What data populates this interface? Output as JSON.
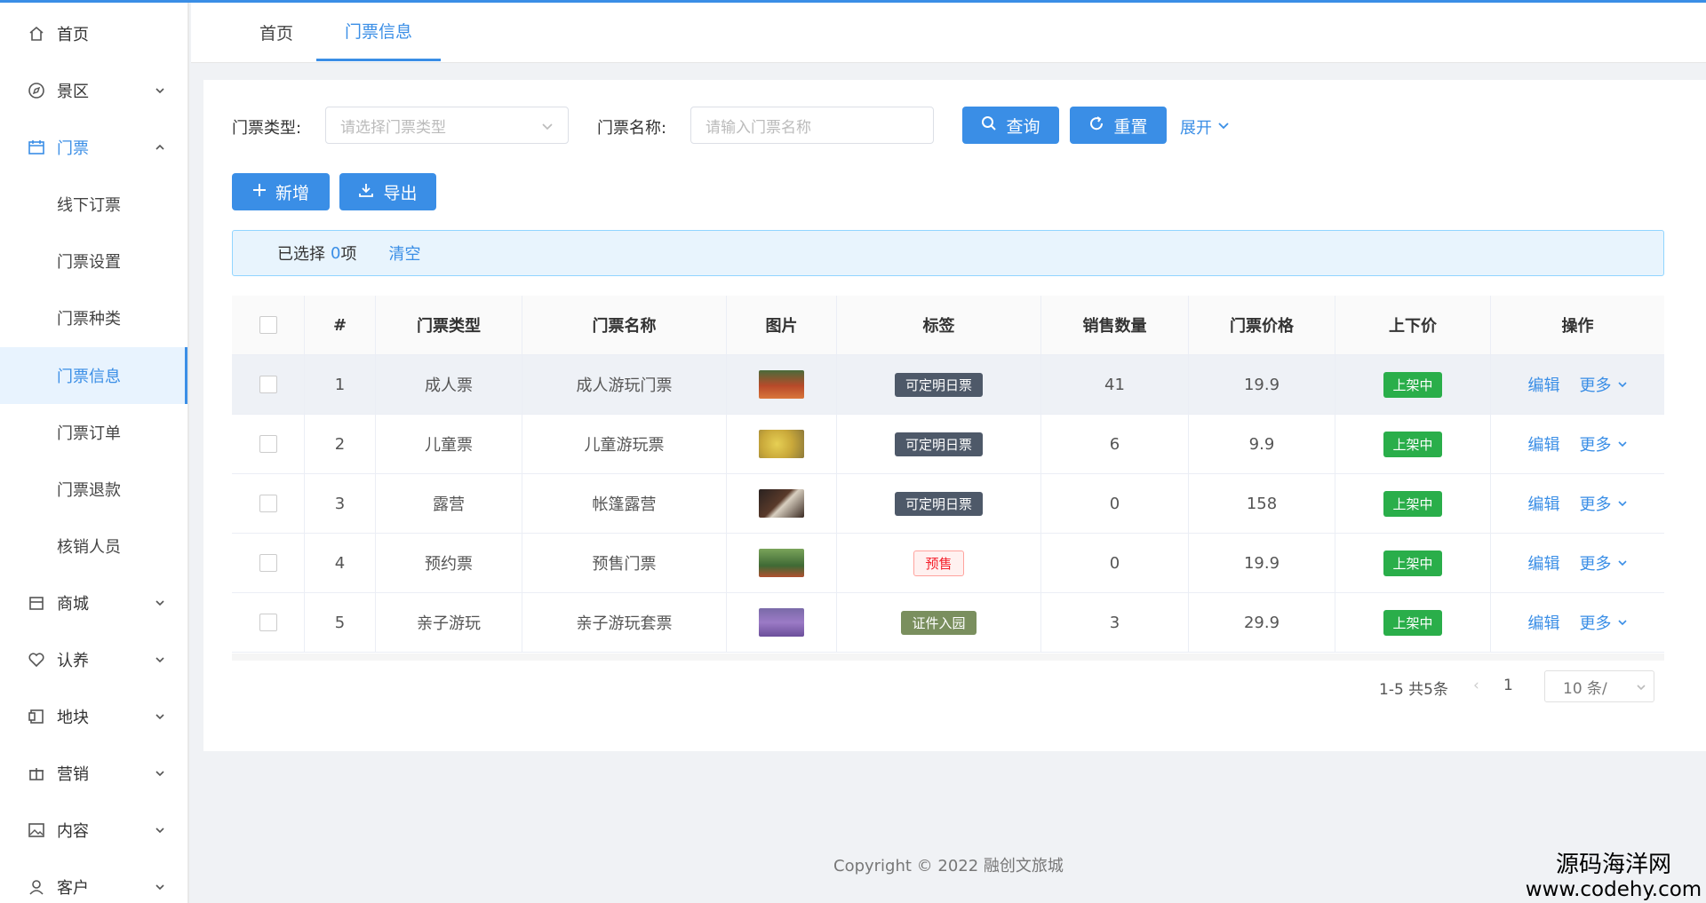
{
  "sidebar": {
    "items": [
      {
        "label": "首页",
        "icon": "home-icon"
      },
      {
        "label": "景区",
        "icon": "compass-icon"
      },
      {
        "label": "门票",
        "icon": "ticket-icon"
      },
      {
        "label": "商城",
        "icon": "shop-icon"
      },
      {
        "label": "认养",
        "icon": "heart-icon"
      },
      {
        "label": "地块",
        "icon": "plot-icon"
      },
      {
        "label": "营销",
        "icon": "gift-icon"
      },
      {
        "label": "内容",
        "icon": "image-icon"
      },
      {
        "label": "客户",
        "icon": "user-icon"
      }
    ],
    "submenu": [
      "线下订票",
      "门票设置",
      "门票种类",
      "门票信息",
      "门票订单",
      "门票退款",
      "核销人员"
    ]
  },
  "tabs": [
    "首页",
    "门票信息"
  ],
  "filter": {
    "type_label": "门票类型:",
    "type_placeholder": "请选择门票类型",
    "name_label": "门票名称:",
    "name_placeholder": "请输入门票名称",
    "query": "查询",
    "reset": "重置",
    "expand": "展开"
  },
  "actions": {
    "add": "新增",
    "export": "导出"
  },
  "selection": {
    "prefix": "已选择",
    "count": "0",
    "suffix": "项",
    "clear": "清空"
  },
  "table": {
    "headers": [
      "#",
      "门票类型",
      "门票名称",
      "图片",
      "标签",
      "销售数量",
      "门票价格",
      "上下价",
      "操作"
    ],
    "rows": [
      {
        "no": "1",
        "type": "成人票",
        "name": "成人游玩门票",
        "tag": "可定明日票",
        "sold": "41",
        "price": "19.9",
        "status": "上架中"
      },
      {
        "no": "2",
        "type": "儿童票",
        "name": "儿童游玩票",
        "tag": "可定明日票",
        "sold": "6",
        "price": "9.9",
        "status": "上架中"
      },
      {
        "no": "3",
        "type": "露营",
        "name": "帐篷露营",
        "tag": "可定明日票",
        "sold": "0",
        "price": "158",
        "status": "上架中"
      },
      {
        "no": "4",
        "type": "预约票",
        "name": "预售门票",
        "tag": "预售",
        "sold": "0",
        "price": "19.9",
        "status": "上架中"
      },
      {
        "no": "5",
        "type": "亲子游玩",
        "name": "亲子游玩套票",
        "tag": "证件入园",
        "sold": "3",
        "price": "29.9",
        "status": "上架中"
      }
    ],
    "edit": "编辑",
    "more": "更多"
  },
  "pagination": {
    "total": "1-5 共5条",
    "page": "1",
    "size": "10 条/"
  },
  "footer": {
    "copyright": "Copyright © 2022 融创文旅城"
  },
  "watermark": {
    "cn": "源码海洋网",
    "url": "www.codehy.com"
  },
  "colors": {
    "primary": "#3a8ee6",
    "success": "#2aae4a",
    "tag_dark": "#4e5969",
    "tag_olive": "#7a8f5e"
  }
}
